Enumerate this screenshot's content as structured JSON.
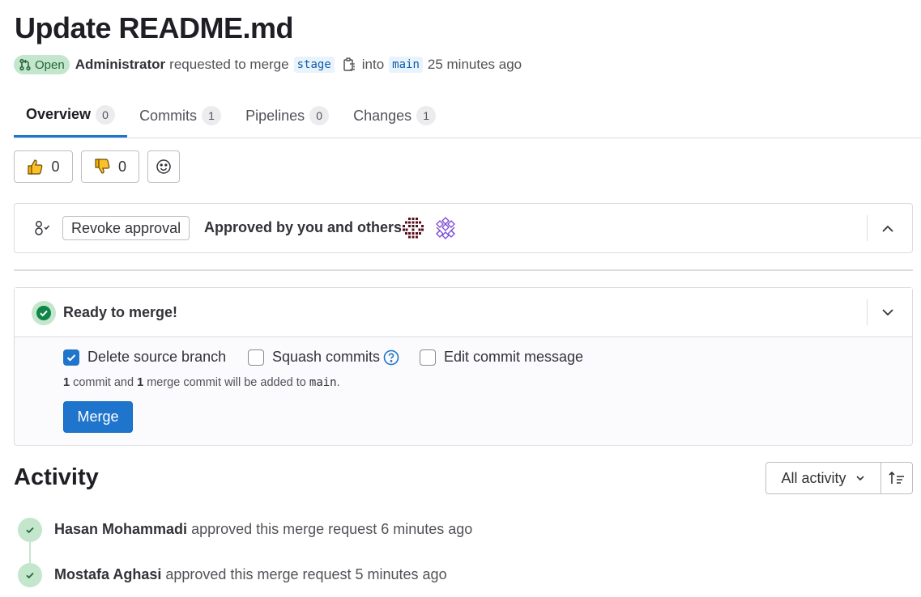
{
  "mr": {
    "title": "Update README.md",
    "status": "Open",
    "author": "Administrator",
    "requested_text": "requested to merge",
    "source_branch": "stage",
    "into_text": "into",
    "target_branch": "main",
    "time_ago": "25 minutes ago"
  },
  "tabs": [
    {
      "label": "Overview",
      "count": "0"
    },
    {
      "label": "Commits",
      "count": "1"
    },
    {
      "label": "Pipelines",
      "count": "0"
    },
    {
      "label": "Changes",
      "count": "1"
    }
  ],
  "reactions": {
    "thumbs_up": "0",
    "thumbs_down": "0"
  },
  "approval": {
    "revoke_label": "Revoke approval",
    "approved_text": "Approved by you and others"
  },
  "merge_widget": {
    "status_text": "Ready to merge!",
    "options": [
      {
        "label": "Delete source branch",
        "checked": true
      },
      {
        "label": "Squash commits",
        "checked": false
      },
      {
        "label": "Edit commit message",
        "checked": false
      }
    ],
    "note": {
      "commit_count": "1",
      "part1": "commit and",
      "merge_count": "1",
      "part2": "merge commit will be added to",
      "branch": "main",
      "end": "."
    },
    "merge_label": "Merge"
  },
  "activity": {
    "heading": "Activity",
    "filter_label": "All activity",
    "items": [
      {
        "user": "Hasan Mohammadi",
        "text": "approved this merge request 6 minutes ago"
      },
      {
        "user": "Mostafa Aghasi",
        "text": "approved this merge request 5 minutes ago"
      }
    ]
  },
  "colors": {
    "accent": "#1f75cb",
    "success_bg": "#c3e6cd",
    "success_fg": "#108548"
  }
}
